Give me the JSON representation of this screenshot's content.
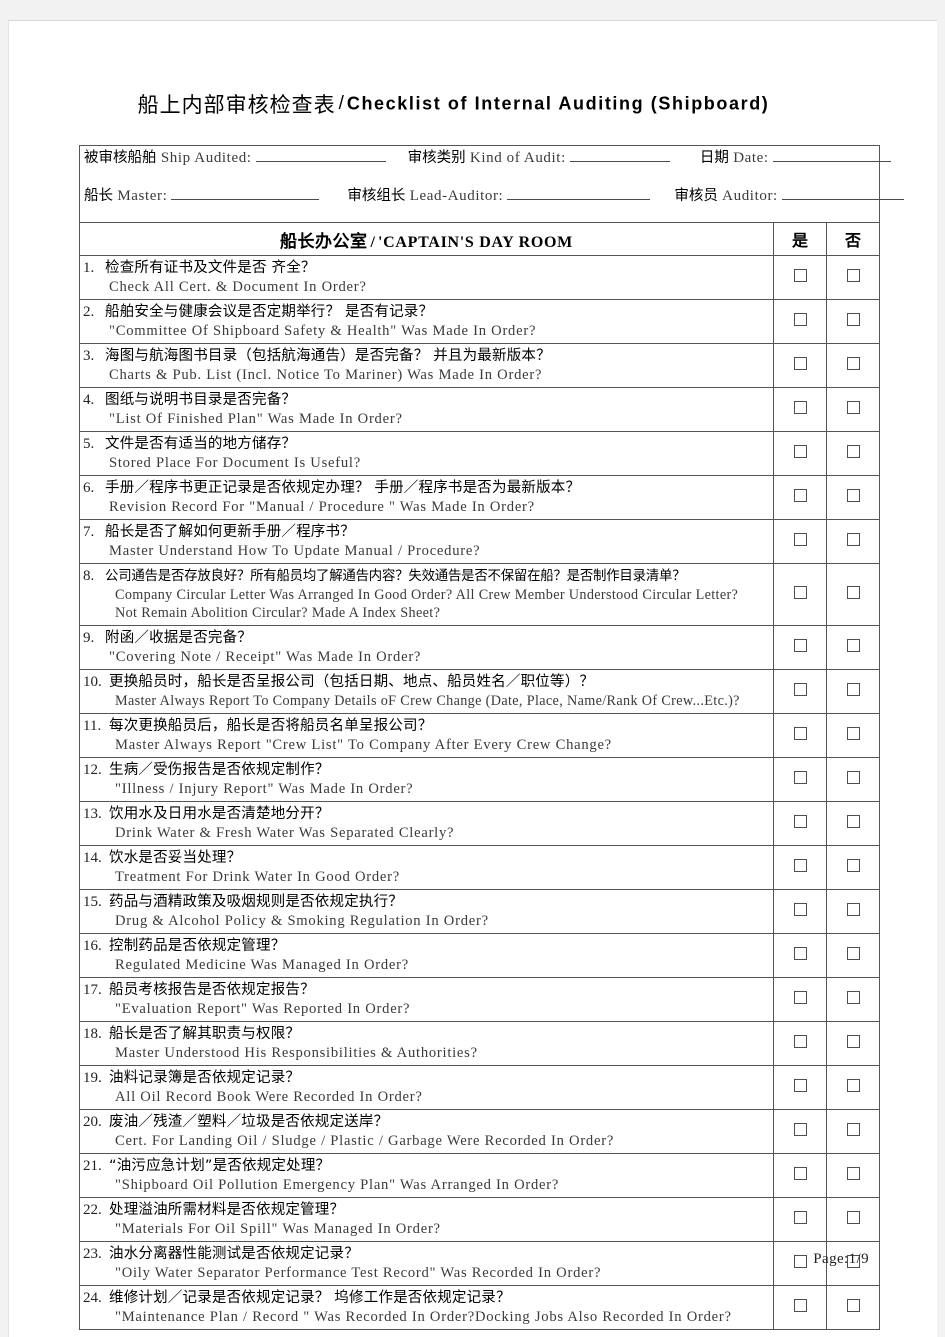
{
  "title": {
    "cn": "船上内部审核检查表",
    "separator": "/",
    "en": "Checklist of Internal Auditing (Shipboard)"
  },
  "meta": {
    "row1": [
      {
        "cn": "被审核船舶",
        "en": "Ship Audited:",
        "blank_width": 130
      },
      {
        "cn": "审核类别",
        "en": "Kind of Audit:",
        "blank_width": 100
      },
      {
        "cn": "日期",
        "en": "Date:",
        "blank_width": 118
      }
    ],
    "row2": [
      {
        "cn": "船长",
        "en": "Master:",
        "blank_width": 148
      },
      {
        "cn": "审核组长",
        "en": "Lead-Auditor:",
        "blank_width": 143
      },
      {
        "cn": "审核员",
        "en": "Auditor:",
        "blank_width": 122
      }
    ]
  },
  "section": {
    "cn": "船长办公室",
    "separator": "/",
    "en": "'CAPTAIN'S DAY ROOM",
    "yes_label": "是",
    "no_label": "否"
  },
  "items": [
    {
      "num": "1.",
      "cn": "检查所有证书及文件是否 齐全？",
      "en": [
        "Check All Cert. & Document In Order?"
      ]
    },
    {
      "num": "2.",
      "cn": "船舶安全与健康会议是否定期举行？  是否有记录？",
      "en": [
        "\"Committee Of Shipboard Safety & Health\" Was Made In Order?"
      ]
    },
    {
      "num": "3.",
      "cn": "海图与航海图书目录（包括航海通告）是否完备？  并且为最新版本？",
      "en": [
        "Charts & Pub. List (Incl. Notice To Mariner) Was Made In Order?"
      ]
    },
    {
      "num": "4.",
      "cn": "图纸与说明书目录是否完备？",
      "en": [
        "\"List Of Finished Plan\" Was Made In Order?"
      ]
    },
    {
      "num": "5.",
      "cn": "文件是否有适当的地方储存？",
      "en": [
        "Stored Place For Document Is Useful?"
      ]
    },
    {
      "num": "6.",
      "cn": "手册／程序书更正记录是否依规定办理？  手册／程序书是否为最新版本？",
      "en": [
        "Revision Record For \"Manual / Procedure \" Was Made In Order?"
      ]
    },
    {
      "num": "7.",
      "cn": "船长是否了解如何更新手册／程序书？",
      "en": [
        "Master Understand How To Update Manual / Procedure?"
      ]
    },
    {
      "num": "8.",
      "cn": "公司通告是否存放良好？所有船员均了解通告内容？失效通告是否不保留在船？是否制作目录清单？",
      "cn_tight": true,
      "en": [
        "Company Circular Letter Was Arranged In Good Order? All Crew Member Understood Circular Letter?",
        "Not Remain Abolition Circular? Made A Index Sheet?"
      ],
      "en_tight": true,
      "indent_en": true
    },
    {
      "num": "9.",
      "cn": "附函／收据是否完备？",
      "en": [
        "\"Covering Note / Receipt\" Was Made In Order?"
      ]
    },
    {
      "num": "10.",
      "cn": "更换船员时，船长是否呈报公司（包括日期、地点、船员姓名／职位等）？",
      "en": [
        "Master Always Report To Company Details oF Crew Change (Date, Place, Name/Rank Of Crew...Etc.)?"
      ],
      "en_tight": true,
      "wide_num": true,
      "indent_en": true
    },
    {
      "num": "11.",
      "cn": "每次更换船员后，船长是否将船员名单呈报公司？",
      "en": [
        "Master Always Report \"Crew List\" To Company After Every Crew Change?"
      ],
      "wide_num": true,
      "indent_en": true
    },
    {
      "num": "12.",
      "cn": "生病／受伤报告是否依规定制作？",
      "en": [
        "\"Illness / Injury Report\" Was Made In Order?"
      ],
      "wide_num": true,
      "indent_en": true
    },
    {
      "num": "13.",
      "cn": "饮用水及日用水是否清楚地分开？",
      "en": [
        "Drink Water & Fresh Water Was Separated Clearly?"
      ],
      "wide_num": true,
      "indent_en": true
    },
    {
      "num": "14.",
      "cn": "饮水是否妥当处理？",
      "en": [
        "Treatment For Drink Water In Good Order?"
      ],
      "wide_num": true,
      "indent_en": true
    },
    {
      "num": "15.",
      "cn": "药品与酒精政策及吸烟规则是否依规定执行？",
      "en": [
        "Drug & Alcohol Policy & Smoking Regulation In Order?"
      ],
      "wide_num": true,
      "indent_en": true
    },
    {
      "num": "16.",
      "cn": "控制药品是否依规定管理？",
      "en": [
        "Regulated Medicine Was Managed In Order?"
      ],
      "wide_num": true,
      "indent_en": true
    },
    {
      "num": "17.",
      "cn": "船员考核报告是否依规定报告？",
      "en": [
        "\"Evaluation Report\" Was Reported In Order?"
      ],
      "wide_num": true,
      "indent_en": true
    },
    {
      "num": "18.",
      "cn": "船长是否了解其职责与权限？",
      "en": [
        "Master Understood His Responsibilities & Authorities?"
      ],
      "wide_num": true,
      "indent_en": true
    },
    {
      "num": "19.",
      "cn": "油料记录簿是否依规定记录？",
      "en": [
        "All Oil Record Book Were Recorded In Order?"
      ],
      "wide_num": true,
      "indent_en": true
    },
    {
      "num": "20.",
      "cn": "废油／残渣／塑料／垃圾是否依规定送岸？",
      "en": [
        "Cert. For Landing Oil / Sludge / Plastic / Garbage Were Recorded In Order?"
      ],
      "wide_num": true,
      "indent_en": true
    },
    {
      "num": "21.",
      "cn": "“油污应急计划”是否依规定处理？",
      "en": [
        "\"Shipboard Oil Pollution Emergency Plan\" Was Arranged In Order?"
      ],
      "wide_num": true,
      "indent_en": true
    },
    {
      "num": "22.",
      "cn": "处理溢油所需材料是否依规定管理？",
      "en": [
        "\"Materials For Oil Spill\" Was Managed In Order?"
      ],
      "wide_num": true,
      "indent_en": true
    },
    {
      "num": "23.",
      "cn": "油水分离器性能测试是否依规定记录？",
      "en": [
        "\"Oily Water Separator Performance Test Record\" Was Recorded In Order?"
      ],
      "wide_num": true,
      "indent_en": true
    },
    {
      "num": "24.",
      "cn": "维修计划／记录是否依规定记录？  坞修工作是否依规定记录？",
      "en": [
        "\"Maintenance Plan / Record \" Was Recorded In Order?Docking Jobs Also Recorded In Order?"
      ],
      "wide_num": true,
      "indent_en": true
    }
  ],
  "footer": {
    "page_label": "Page:1/9"
  },
  "colors": {
    "border": "#555555",
    "text": "#000000",
    "english_text": "#3a3a3a",
    "page_background": "#ffffff",
    "viewer_background": "#f2f2f2"
  }
}
